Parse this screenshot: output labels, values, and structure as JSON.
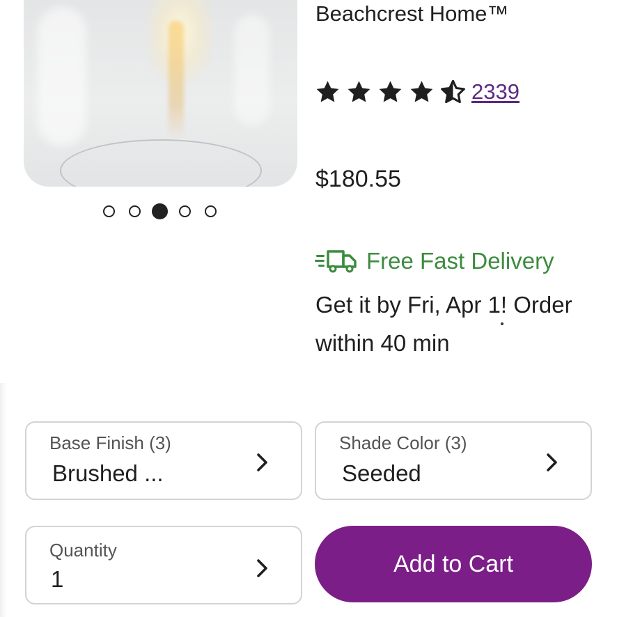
{
  "product": {
    "brand": "Beachcrest Home™",
    "rating": 4.5,
    "review_count": "2339",
    "price": "$180.55"
  },
  "gallery": {
    "dot_count": 5,
    "active_index": 2
  },
  "delivery": {
    "label": "Free Fast Delivery",
    "text": "Get it by Fri, Apr 1! Order within 40 min",
    "icon": "delivery-truck-icon"
  },
  "options": {
    "base_finish": {
      "label": "Base Finish (3)",
      "value": "Brushed ..."
    },
    "shade_color": {
      "label": "Shade Color (3)",
      "value": "Seeded"
    },
    "quantity": {
      "label": "Quantity",
      "value": "1"
    }
  },
  "actions": {
    "add_to_cart_label": "Add to Cart"
  },
  "colors": {
    "accent_purple": "#7b1e87",
    "link_purple": "#5b2a82",
    "delivery_green": "#3c8b3f"
  }
}
